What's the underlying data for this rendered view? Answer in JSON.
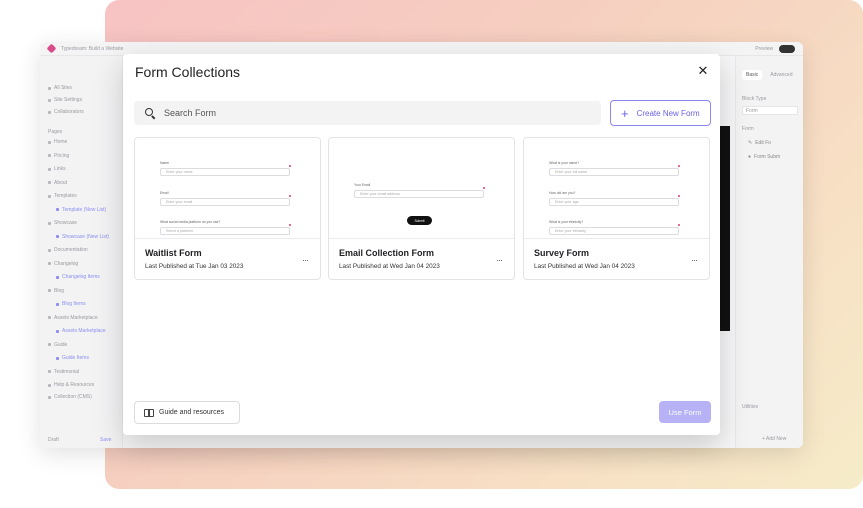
{
  "app": {
    "title": "Typedream: Build a Website",
    "topbar_right": [
      "Preview"
    ],
    "sidebar": {
      "top_items": [
        "All Sites",
        "Site Settings",
        "Collaborators"
      ],
      "section_label": "Pages",
      "pages": [
        {
          "label": "Home",
          "accent": false
        },
        {
          "label": "Pricing",
          "accent": false
        },
        {
          "label": "Links",
          "accent": false
        },
        {
          "label": "About",
          "accent": false
        },
        {
          "label": "Templates",
          "accent": false
        },
        {
          "label": "Template (New List)",
          "accent": true
        },
        {
          "label": "Showcase",
          "accent": false
        },
        {
          "label": "Showcase (New List)",
          "accent": true
        },
        {
          "label": "Documentation",
          "accent": false
        },
        {
          "label": "Changelog",
          "accent": false
        },
        {
          "label": "Changelog Items",
          "accent": true
        },
        {
          "label": "Blog",
          "accent": false
        },
        {
          "label": "Blog Items",
          "accent": true
        },
        {
          "label": "Assets Marketplace",
          "accent": false
        },
        {
          "label": "Assets Marketplace",
          "accent": true
        },
        {
          "label": "Guide",
          "accent": false
        },
        {
          "label": "Guide Items",
          "accent": true
        },
        {
          "label": "Testimonial",
          "accent": false
        }
      ],
      "bottom_items": [
        "Help & Resources",
        "Collection (CMS)"
      ],
      "footer_left": "Draft",
      "footer_right": "Save"
    },
    "right_panel": {
      "tabs": [
        "Basic",
        "Advanced"
      ],
      "block_type_label": "Block Type",
      "block_type_value": "Form",
      "form_label": "Form",
      "edit_label": "Edit Fo",
      "submit_label": "Form Subm",
      "utilities_label": "Utilities",
      "add_new_label": "+ Add New"
    }
  },
  "modal": {
    "title": "Form Collections",
    "close_icon": "close-icon",
    "search": {
      "placeholder": "Search Form"
    },
    "create_button": "Create New Form",
    "cards": [
      {
        "title": "Waitlist Form",
        "subtitle": "Last Published at Tue Jan 03 2023",
        "more": "···",
        "preview": {
          "f1_label": "Name",
          "f1_placeholder": "Enter your name",
          "f2_label": "Email",
          "f2_placeholder": "Enter your email",
          "f3_label": "What social media platform do you use?",
          "f3_placeholder": "Select a platform"
        }
      },
      {
        "title": "Email Collection Form",
        "subtitle": "Last Published at Wed Jan 04 2023",
        "more": "···",
        "preview": {
          "f1_label": "Your Email",
          "f1_placeholder": "Enter your email address",
          "submit": "Submit"
        }
      },
      {
        "title": "Survey Form",
        "subtitle": "Last Published at Wed Jan 04 2023",
        "more": "···",
        "preview": {
          "f1_label": "What is your name?",
          "f1_placeholder": "Enter your full name",
          "f2_label": "How old are you?",
          "f2_placeholder": "Enter your age",
          "f3_label": "What is your ethnicity?",
          "f3_placeholder": "Enter your ethnicity"
        }
      }
    ],
    "guide_button": "Guide and resources",
    "use_button": "Use Form"
  },
  "colors": {
    "accent": "#6b63e8",
    "accent_disabled": "#b6b2f5",
    "required_dot": "#e33a6b"
  }
}
